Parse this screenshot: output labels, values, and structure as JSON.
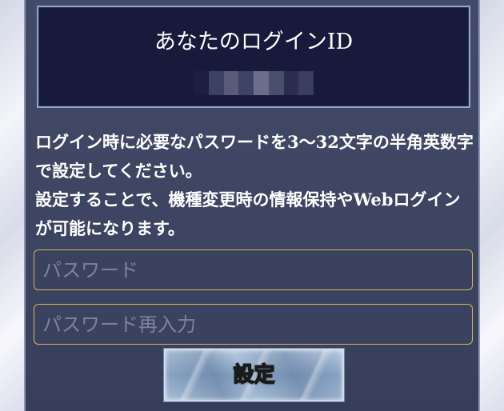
{
  "login_id_panel": {
    "title": "あなたのログインID",
    "id_value_mosaic": [
      "#1c1f41",
      "#3d4162",
      "#585c7a",
      "#3e4264",
      "#6a6e8a",
      "#4b4f6e",
      "#2a2d4d",
      "#3a3e5e"
    ]
  },
  "description": {
    "paragraph_1": "ログイン時に必要なパスワードを3〜32文字の半角英数字で設定してください。",
    "paragraph_2": "設定することで、機種変更時の情報保持やWebログインが可能になります。"
  },
  "form": {
    "password_placeholder": "パスワード",
    "password_value": "",
    "password_confirm_placeholder": "パスワード再入力",
    "password_confirm_value": "",
    "submit_label": "設定"
  },
  "colors": {
    "panel_background": "#3e4562",
    "id_box_background": "#171a3a",
    "input_border": "#d4b65a",
    "text": "#ffffff"
  }
}
